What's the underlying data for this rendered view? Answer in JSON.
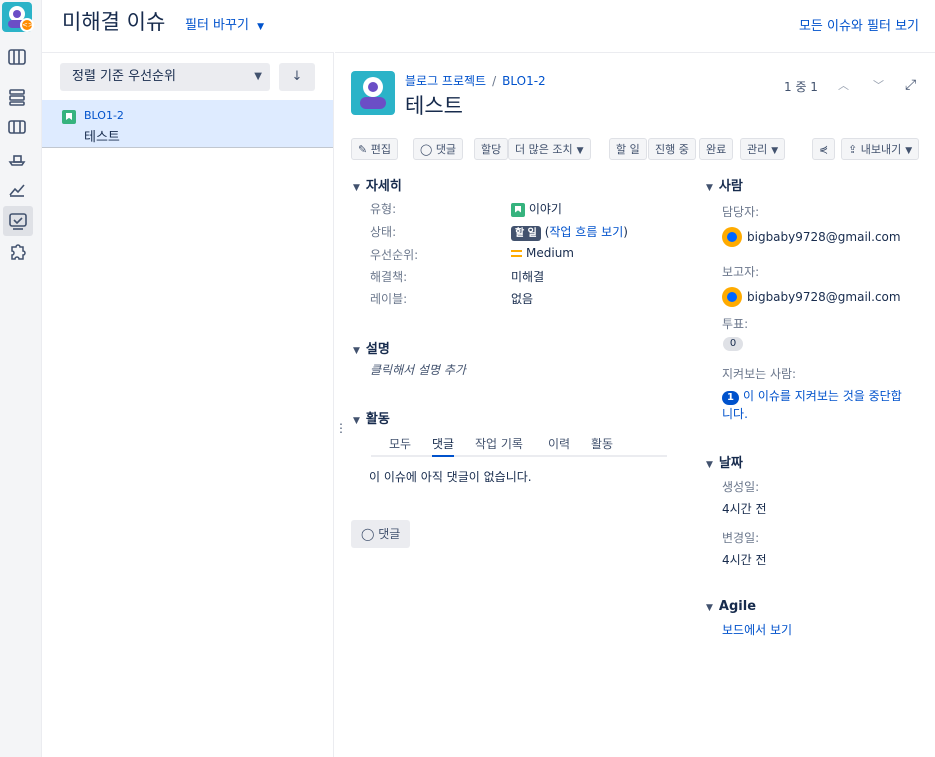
{
  "header": {
    "title": "미해결 이슈",
    "switch_filter": "필터 바꾸기",
    "view_all": "모든 이슈와 필터 보기"
  },
  "rail": {
    "icons": [
      "project-avatar-icon",
      "backlog-icon",
      "board-icon",
      "columns-icon",
      "releases-icon",
      "reports-icon",
      "issues-icon",
      "addons-icon"
    ]
  },
  "list": {
    "sort_label": "정렬 기준 우선순위",
    "sort_direction": "↓",
    "items": [
      {
        "key": "BLO1-2",
        "summary": "테스트",
        "type_icon": "story-icon"
      }
    ]
  },
  "issue": {
    "breadcrumb_project": "블로그 프로젝트",
    "breadcrumb_sep": "/",
    "breadcrumb_key": "BLO1-2",
    "title": "테스트",
    "pager_text": "1 중 1",
    "toolbar": {
      "edit": "편집",
      "comment": "댓글",
      "assign": "할당",
      "more": "더 많은 조치",
      "todo": "할 일",
      "inprogress": "진행 중",
      "done": "완료",
      "admin": "관리",
      "share": "",
      "export": "내보내기"
    },
    "details": {
      "heading": "자세히",
      "type_label": "유형:",
      "type_value": "이야기",
      "status_label": "상태:",
      "status_value": "할 일",
      "workflow_link": "작업 흐름 보기",
      "priority_label": "우선순위:",
      "priority_value": "Medium",
      "resolution_label": "해결책:",
      "resolution_value": "미해결",
      "labels_label": "레이블:",
      "labels_value": "없음"
    },
    "description": {
      "heading": "설명",
      "placeholder": "클릭해서 설명 추가"
    },
    "activity": {
      "heading": "활동",
      "tabs": [
        "모두",
        "댓글",
        "작업 기록",
        "이력",
        "활동"
      ],
      "active_tab": "댓글",
      "empty": "이 이슈에 아직 댓글이 없습니다.",
      "comment_button": "댓글"
    },
    "people": {
      "heading": "사람",
      "assignee_label": "담당자:",
      "assignee": "bigbaby9728@gmail.com",
      "reporter_label": "보고자:",
      "reporter": "bigbaby9728@gmail.com",
      "votes_label": "투표:",
      "votes": "0",
      "watchers_label": "지켜보는 사람:",
      "watchers": "1",
      "stop_watching_line1": "이 이슈를 지켜보는 것을 중단합",
      "stop_watching_line2": "니다."
    },
    "dates": {
      "heading": "날짜",
      "created_label": "생성일:",
      "created": "4시간 전",
      "updated_label": "변경일:",
      "updated": "4시간 전"
    },
    "agile": {
      "heading": "Agile",
      "view_on_board": "보드에서 보기"
    }
  }
}
